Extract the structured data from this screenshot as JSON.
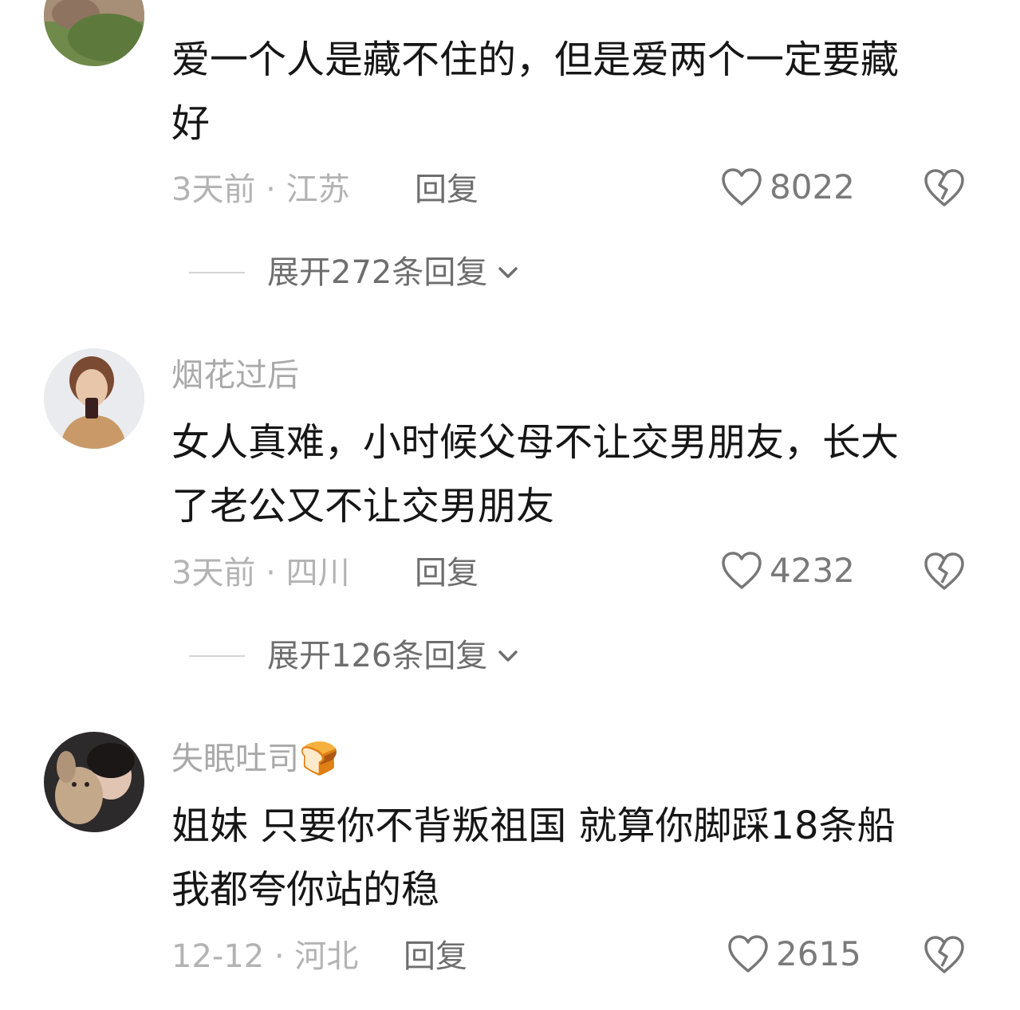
{
  "comments": [
    {
      "username": "",
      "text_lines": [
        "爱一个人是藏不住的，但是爱两个一定要藏",
        "好"
      ],
      "time": "3天前",
      "location": "江苏",
      "reply_label": "回复",
      "likes": "8022",
      "expand_label": "展开272条回复"
    },
    {
      "username": "烟花过后",
      "text_lines": [
        "女人真难，小时候父母不让交男朋友，长大",
        "了老公又不让交男朋友"
      ],
      "time": "3天前",
      "location": "四川",
      "reply_label": "回复",
      "likes": "4232",
      "expand_label": "展开126条回复"
    },
    {
      "username": "失眠吐司🍞",
      "text_lines": [
        "姐妹 只要你不背叛祖国 就算你脚踩18条船",
        "我都夸你站的稳"
      ],
      "time": "12-12",
      "location": "河北",
      "reply_label": "回复",
      "likes": "2615"
    }
  ],
  "meta_separator": "·",
  "icons": {
    "like": "heart-outline-icon",
    "dislike": "broken-heart-icon",
    "expand": "chevron-down-icon"
  },
  "colors": {
    "text": "#161616",
    "muted": "#b3b3b3",
    "secondary": "#6e6e6e"
  }
}
